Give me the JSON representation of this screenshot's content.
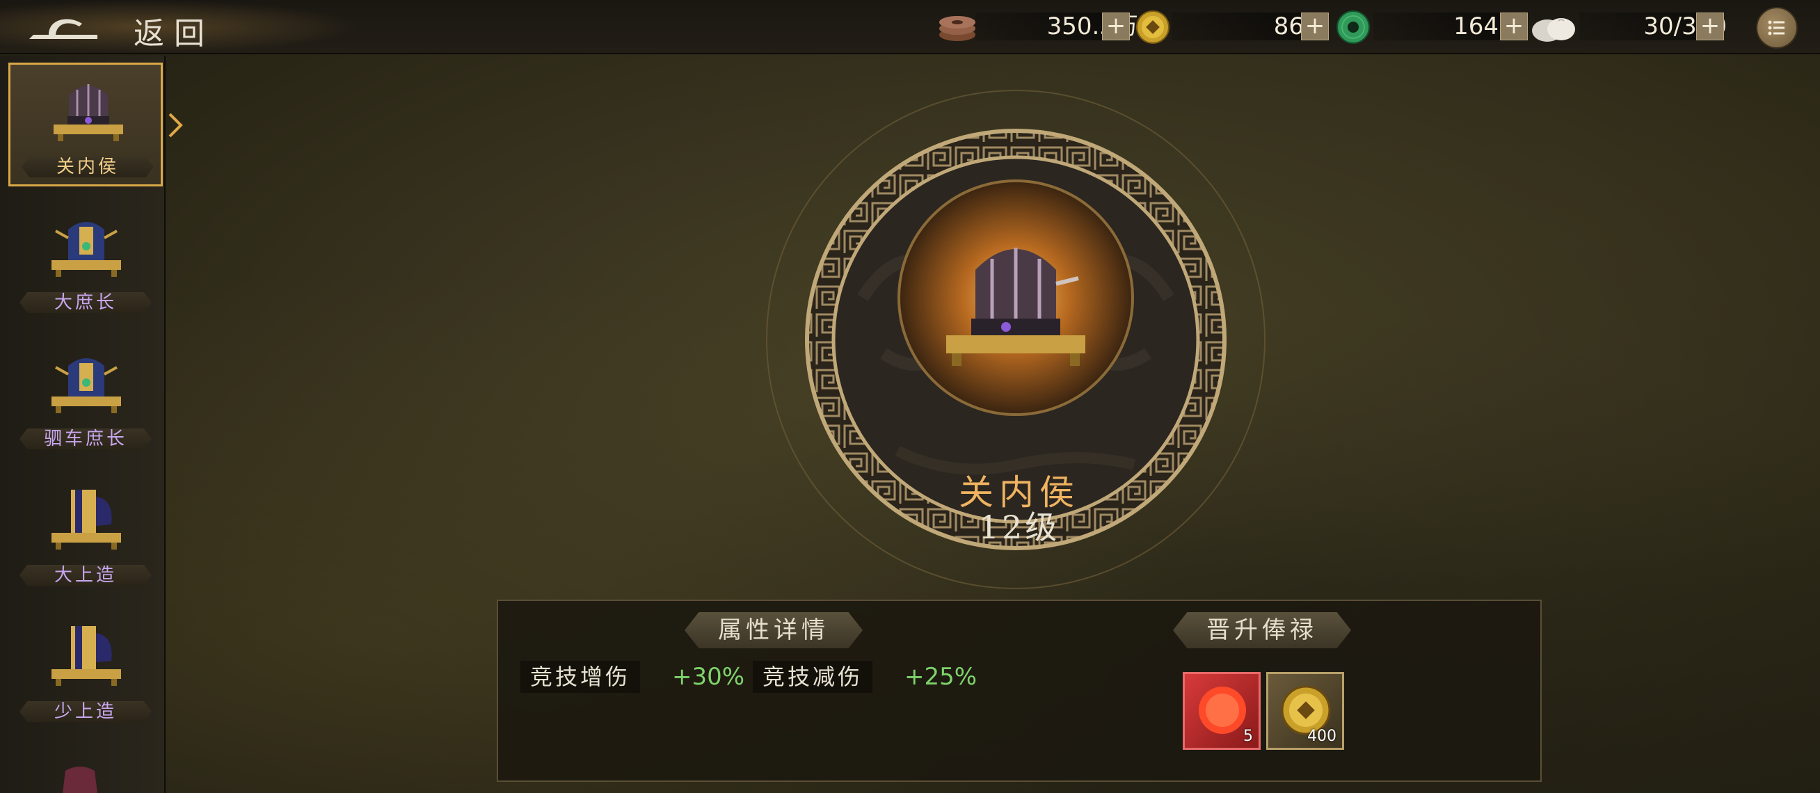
{
  "header": {
    "back_label": "返回",
    "resources": [
      {
        "name": "copper-coins",
        "value": "350.5万"
      },
      {
        "name": "gold-coin",
        "value": "86"
      },
      {
        "name": "jade-disc",
        "value": "164"
      },
      {
        "name": "steamed-bun",
        "value": "30/300"
      }
    ],
    "plus": "+"
  },
  "sidebar": {
    "items": [
      {
        "label": "关内侯",
        "active": true
      },
      {
        "label": "大庶长",
        "active": false
      },
      {
        "label": "驷车庶长",
        "active": false
      },
      {
        "label": "大上造",
        "active": false
      },
      {
        "label": "少上造",
        "active": false
      }
    ]
  },
  "rank": {
    "title": "关内侯",
    "level": "12级"
  },
  "attributes": {
    "tab_label": "属性详情",
    "stats": [
      {
        "name": "竞技增伤",
        "value": "+30%"
      },
      {
        "name": "竞技减伤",
        "value": "+25%"
      }
    ]
  },
  "promotion": {
    "tab_label": "晋升俸禄",
    "rewards": [
      {
        "icon": "red-orb-icon",
        "count": "5"
      },
      {
        "icon": "gold-coin-icon",
        "count": "400"
      }
    ]
  },
  "colors": {
    "accent": "#d9a848",
    "stat_value": "#7ed36a",
    "rank_title": "#f0b360",
    "sidebar_label": "#c9a7f0"
  }
}
